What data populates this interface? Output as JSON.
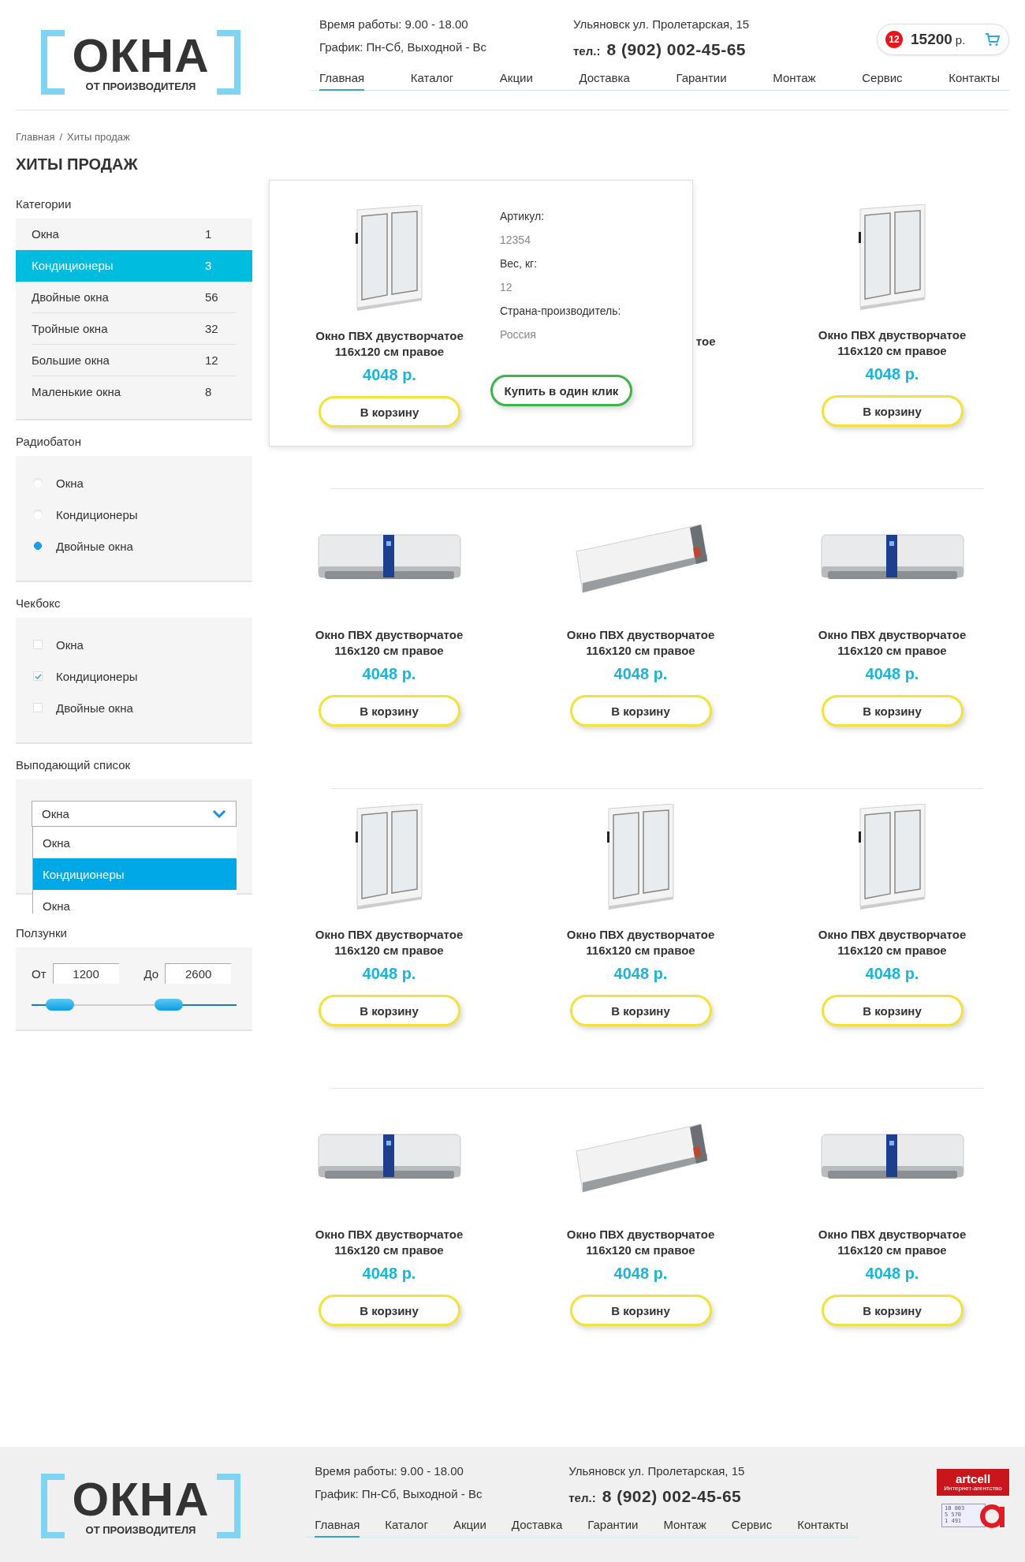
{
  "header": {
    "logo": {
      "word": "ОКНА",
      "tagline": "ОТ ПРОИЗВОДИТЕЛЯ"
    },
    "hours": "Время работы: 9.00 - 18.00",
    "schedule": "График: Пн-Сб, Выходной - Вс",
    "address": "Ульяновск ул. Пролетарская, 15",
    "phone_label": "тел.:",
    "phone": "8 (902) 002-45-65",
    "cart": {
      "count": "12",
      "amount": "15200",
      "currency": "р."
    },
    "nav": [
      {
        "label": "Главная",
        "selected": true
      },
      {
        "label": "Каталог",
        "selected": false
      },
      {
        "label": "Акции",
        "selected": false
      },
      {
        "label": "Доставка",
        "selected": false
      },
      {
        "label": "Гарантии",
        "selected": false
      },
      {
        "label": "Монтаж",
        "selected": false
      },
      {
        "label": "Сервис",
        "selected": false
      },
      {
        "label": "Контакты",
        "selected": false
      }
    ]
  },
  "breadcrumbs": [
    "Главная",
    "Хиты продаж"
  ],
  "breadcrumb_separator": "/",
  "page_title": "ХИТЫ ПРОДАЖ",
  "sidebar": {
    "categories": {
      "title": "Категории",
      "items": [
        {
          "label": "Окна",
          "count": "1",
          "selected": false
        },
        {
          "label": "Кондиционеры",
          "count": "3",
          "selected": true
        },
        {
          "label": "Двойные окна",
          "count": "56",
          "selected": false
        },
        {
          "label": "Тройные окна",
          "count": "32",
          "selected": false
        },
        {
          "label": "Большие окна",
          "count": "12",
          "selected": false
        },
        {
          "label": "Маленькие окна",
          "count": "8",
          "selected": false
        }
      ]
    },
    "radios": {
      "title": "Радиобатон",
      "items": [
        {
          "label": "Окна",
          "selected": false
        },
        {
          "label": "Кондиционеры",
          "selected": false
        },
        {
          "label": "Двойные окна",
          "selected": true
        }
      ]
    },
    "checkboxes": {
      "title": "Чекбокс",
      "items": [
        {
          "label": "Окна",
          "checked": false
        },
        {
          "label": "Кондиционеры",
          "checked": true
        },
        {
          "label": "Двойные окна",
          "checked": false
        }
      ]
    },
    "dropdown": {
      "title": "Выподающий список",
      "value": "Окна",
      "expanded": true,
      "options": [
        {
          "label": "Окна",
          "highlighted": false
        },
        {
          "label": "Кондиционеры",
          "highlighted": true
        },
        {
          "label": "Окна",
          "highlighted": false
        }
      ]
    },
    "range": {
      "title": "Ползунки",
      "from_label": "От",
      "from": "1200",
      "to_label": "До",
      "to": "2600",
      "handles": [
        {
          "level": 0.14
        },
        {
          "level": 0.67
        }
      ]
    }
  },
  "products": [
    {
      "kind": "window",
      "title": "Окно ПВХ двустворчатое 116x120 см правое",
      "price": "4048 р.",
      "button": "В корзину",
      "details": [
        {
          "label": "Артикул:",
          "value": "12354"
        },
        {
          "label": "Вес, кг:",
          "value": "12"
        },
        {
          "label": "Страна-производитель:",
          "value": "Россия"
        }
      ],
      "quick_buy": "Купить в один клик"
    },
    {
      "title_fragment": "тое"
    },
    {
      "kind": "window",
      "title": "Окно ПВХ двустворчатое 116x120 см правое",
      "price": "4048 р.",
      "button": "В корзину"
    },
    {
      "kind": "ac",
      "title": "Окно ПВХ двустворчатое 116x120 см правое",
      "price": "4048 р.",
      "button": "В корзину"
    },
    {
      "kind": "ac-angled",
      "title": "Окно ПВХ двустворчатое 116x120 см правое",
      "price": "4048 р.",
      "button": "В корзину"
    },
    {
      "kind": "ac",
      "title": "Окно ПВХ двустворчатое 116x120 см правое",
      "price": "4048 р.",
      "button": "В корзину"
    },
    {
      "kind": "window",
      "title": "Окно ПВХ двустворчатое 116x120 см правое",
      "price": "4048 р.",
      "button": "В корзину"
    },
    {
      "kind": "window",
      "title": "Окно ПВХ двустворчатое 116x120 см правое",
      "price": "4048 р.",
      "button": "В корзину"
    },
    {
      "kind": "window",
      "title": "Окно ПВХ двустворчатое 116x120 см правое",
      "price": "4048 р.",
      "button": "В корзину"
    },
    {
      "kind": "ac",
      "title": "Окно ПВХ двустворчатое 116x120 см правое",
      "price": "4048 р.",
      "button": "В корзину"
    },
    {
      "kind": "ac-angled",
      "title": "Окно ПВХ двустворчатое 116x120 см правое",
      "price": "4048 р.",
      "button": "В корзину"
    },
    {
      "kind": "ac",
      "title": "Окно ПВХ двустворчатое 116x120 см правое",
      "price": "4048 р.",
      "button": "В корзину"
    }
  ],
  "footer": {
    "logo": {
      "word": "ОКНА",
      "tagline": "ОТ ПРОИЗВОДИТЕЛЯ"
    },
    "hours": "Время работы: 9.00 - 18.00",
    "schedule": "График: Пн-Сб, Выходной - Вс",
    "address": "Ульяновск ул. Пролетарская, 15",
    "phone_label": "тел.:",
    "phone": "8 (902) 002-45-65",
    "nav": [
      {
        "label": "Главная",
        "selected": true
      },
      {
        "label": "Каталог",
        "selected": false
      },
      {
        "label": "Акции",
        "selected": false
      },
      {
        "label": "Доставка",
        "selected": false
      },
      {
        "label": "Гарантии",
        "selected": false
      },
      {
        "label": "Монтаж",
        "selected": false
      },
      {
        "label": "Сервис",
        "selected": false
      },
      {
        "label": "Контакты",
        "selected": false
      }
    ],
    "agency": {
      "name": "artcell",
      "tagline": "Интернет-агентство"
    },
    "counter": [
      "10 803",
      "5 570",
      "1 491"
    ]
  }
}
